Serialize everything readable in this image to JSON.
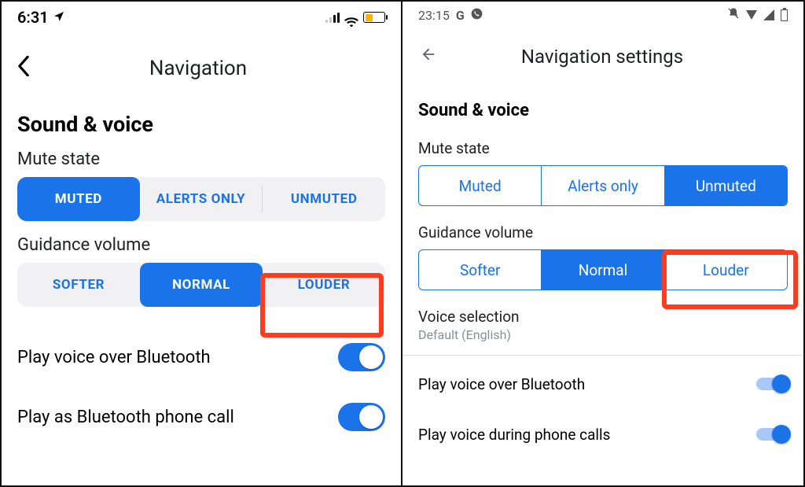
{
  "left": {
    "status": {
      "time": "6:31"
    },
    "header": {
      "title": "Navigation"
    },
    "section_title": "Sound & voice",
    "mute": {
      "label": "Mute state",
      "options": [
        "MUTED",
        "ALERTS ONLY",
        "UNMUTED"
      ],
      "selected_index": 0
    },
    "guidance": {
      "label": "Guidance volume",
      "options": [
        "SOFTER",
        "NORMAL",
        "LOUDER"
      ],
      "selected_index": 1,
      "highlight_index": 2
    },
    "toggles": [
      {
        "label": "Play voice over Bluetooth",
        "on": true
      },
      {
        "label": "Play as Bluetooth phone call",
        "on": true
      }
    ]
  },
  "right": {
    "status": {
      "time": "23:15"
    },
    "header": {
      "title": "Navigation settings"
    },
    "section_title": "Sound & voice",
    "mute": {
      "label": "Mute state",
      "options": [
        "Muted",
        "Alerts only",
        "Unmuted"
      ],
      "selected_index": 2
    },
    "guidance": {
      "label": "Guidance volume",
      "options": [
        "Softer",
        "Normal",
        "Louder"
      ],
      "selected_index": 1,
      "highlight_index": 2
    },
    "voice_selection": {
      "label": "Voice selection",
      "value": "Default (English)"
    },
    "toggles": [
      {
        "label": "Play voice over Bluetooth",
        "on": true
      },
      {
        "label": "Play voice during phone calls",
        "on": true
      }
    ]
  }
}
